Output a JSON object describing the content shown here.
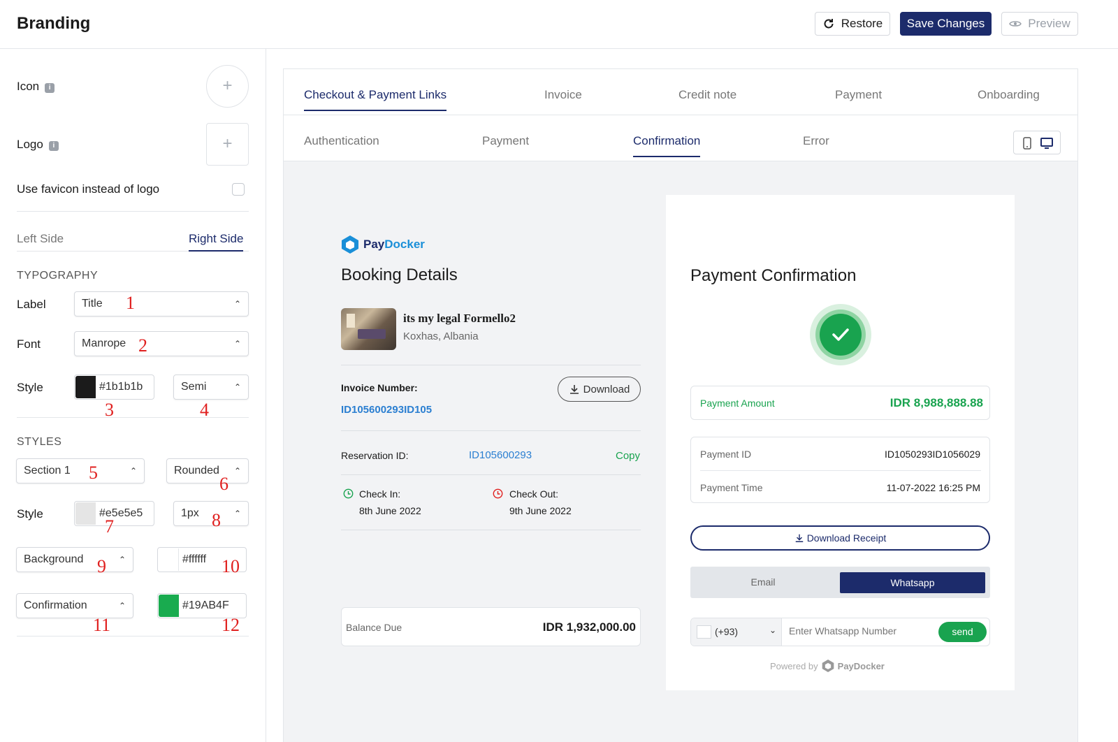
{
  "header": {
    "title": "Branding",
    "restore_label": "Restore",
    "save_label": "Save Changes",
    "preview_label": "Preview"
  },
  "sidebar": {
    "icon_label": "Icon",
    "logo_label": "Logo",
    "favicon_label": "Use favicon instead of logo",
    "favicon_checked": false,
    "side_tabs": [
      "Left Side",
      "Right Side"
    ],
    "active_side": "Right Side",
    "typography_title": "TYPOGRAPHY",
    "label_label": "Label",
    "label_value": "Title",
    "font_label": "Font",
    "font_value": "Manrope",
    "style_label": "Style",
    "text_color": "#1b1b1b",
    "weight_value": "Semi",
    "styles_title": "STYLES",
    "section_value": "Section 1",
    "corner_value": "Rounded",
    "style2_label": "Style",
    "border_color": "#e5e5e5",
    "border_width": "1px",
    "background_label": "Background",
    "background_color": "#ffffff",
    "confirmation_label": "Confirmation",
    "confirmation_color": "#19AB4F",
    "annotations": [
      "1",
      "2",
      "3",
      "4",
      "5",
      "6",
      "7",
      "8",
      "9",
      "10",
      "11",
      "12"
    ]
  },
  "preview": {
    "main_tabs": [
      "Checkout & Payment Links",
      "Invoice",
      "Credit note",
      "Payment",
      "Onboarding"
    ],
    "active_main_tab": "Checkout & Payment Links",
    "sub_tabs": [
      "Authentication",
      "Payment",
      "Confirmation",
      "Error"
    ],
    "active_sub_tab": "Confirmation",
    "left": {
      "brand_pay": "Pay",
      "brand_docker": "Docker",
      "heading": "Booking Details",
      "property_name": "its my legal Formello2",
      "property_location": "Koxhas, Albania",
      "invoice_label": "Invoice Number:",
      "invoice_number": "ID105600293ID105",
      "download_label": "Download",
      "reservation_label": "Reservation ID:",
      "reservation_id": "ID105600293",
      "copy_label": "Copy",
      "checkin_label": "Check In:",
      "checkin_date": "8th June 2022",
      "checkout_label": "Check Out:",
      "checkout_date": "9th June 2022",
      "balance_label": "Balance Due",
      "balance_value": "IDR 1,932,000.00"
    },
    "right": {
      "heading": "Payment Confirmation",
      "amount_label": "Payment Amount",
      "amount_value": "IDR 8,988,888.88",
      "payment_id_label": "Payment ID",
      "payment_id_value": "ID1050293ID1056029",
      "payment_time_label": "Payment Time",
      "payment_time_value": "11-07-2022 16:25 PM",
      "receipt_label": "Download Receipt",
      "share_tabs": [
        "Email",
        "Whatsapp"
      ],
      "active_share": "Whatsapp",
      "country_code": "(+93)",
      "phone_placeholder": "Enter Whatsapp Number",
      "send_label": "send",
      "powered_by": "Powered by",
      "powered_brand": "PayDocker"
    }
  }
}
